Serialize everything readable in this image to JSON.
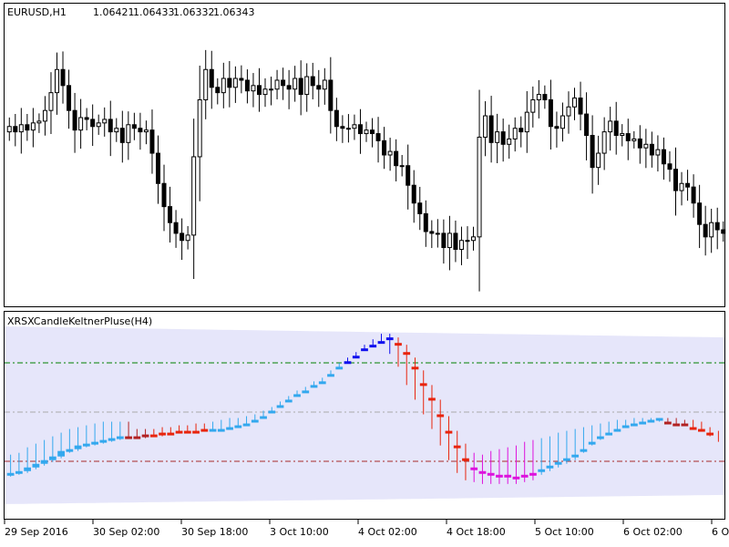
{
  "header": {
    "symbol_label": "EURUSD,H1",
    "ohlc_values": [
      "1.06421",
      "1.06433",
      "1.06332",
      "1.06343"
    ]
  },
  "indicator": {
    "title": "XRSXCandleKeltnerPluse(H4)"
  },
  "time_axis": {
    "labels": [
      "29 Sep 2016",
      "30 Sep 02:00",
      "30 Sep 18:00",
      "3 Oct 10:00",
      "4 Oct 02:00",
      "4 Oct 18:00",
      "5 Oct 10:00",
      "6 Oct 02:00",
      "6 O"
    ]
  },
  "colors": {
    "background": "#ffffff",
    "frame": "#000000",
    "candle_outline": "#000000",
    "band_fill": "#e6e6fa",
    "level_upper": "#008000",
    "level_middle": "#a9a9a9",
    "level_lower": "#a52a2a",
    "light_blue": "#33a8ee",
    "dark_blue": "#1010ee",
    "red": "#e8240c",
    "magenta": "#dd11dd",
    "brown": "#b22222"
  },
  "chart_data": [
    {
      "type": "candlestick",
      "title": "EURUSD,H1",
      "series": [
        {
          "name": "EURUSD,H1",
          "close": [
            1.1196,
            1.1193,
            1.1197,
            1.1194,
            1.1198,
            1.1199,
            1.1205,
            1.1215,
            1.1228,
            1.1219,
            1.1205,
            1.1194,
            1.1201,
            1.12,
            1.1196,
            1.1198,
            1.12,
            1.1193,
            1.1195,
            1.1187,
            1.1197,
            1.1195,
            1.1193,
            1.1194,
            1.1181,
            1.1164,
            1.1151,
            1.1142,
            1.1136,
            1.1132,
            1.1135,
            1.1179,
            1.1211,
            1.1228,
            1.1218,
            1.1215,
            1.1223,
            1.1218,
            1.1223,
            1.1222,
            1.1216,
            1.1219,
            1.1214,
            1.1217,
            1.1217,
            1.1222,
            1.1219,
            1.1217,
            1.1223,
            1.1214,
            1.1224,
            1.1219,
            1.1217,
            1.1222,
            1.1205,
            1.1196,
            1.1195,
            1.1195,
            1.1197,
            1.1192,
            1.1194,
            1.1192,
            1.1188,
            1.118,
            1.1182,
            1.1174,
            1.1174,
            1.1163,
            1.1153,
            1.1147,
            1.1137,
            1.1136,
            1.1136,
            1.1128,
            1.1136,
            1.1127,
            1.1132,
            1.1132,
            1.1134,
            1.119,
            1.1202,
            1.1187,
            1.1193,
            1.1186,
            1.1189,
            1.1195,
            1.1193,
            1.1204,
            1.1211,
            1.1214,
            1.1211,
            1.1196,
            1.1195,
            1.1202,
            1.1207,
            1.1212,
            1.1203,
            1.1191,
            1.1173,
            1.1181,
            1.1193,
            1.1199,
            1.1191,
            1.1192,
            1.1188,
            1.1189,
            1.1184,
            1.1186,
            1.118,
            1.1183,
            1.1175,
            1.1172,
            1.116,
            1.1164,
            1.1162,
            1.1153,
            1.1141,
            1.1134,
            1.1142,
            1.1138,
            1.1136
          ],
          "ylim": [
            1.1095,
            1.1265
          ]
        }
      ]
    },
    {
      "type": "colored-candle-oscillator",
      "title": "XRSXCandleKeltnerPluse(H4)",
      "levels": [
        {
          "name": "upper",
          "value": 80
        },
        {
          "name": "middle",
          "value": 50
        },
        {
          "name": "lower",
          "value": 20
        }
      ],
      "ylim": [
        -3,
        110
      ],
      "series": [
        {
          "name": "XRSXCandleKeltnerPluse(H4)",
          "open": [
            21,
            22,
            23,
            25,
            27,
            29,
            31,
            34,
            35,
            37,
            38,
            39,
            40,
            41,
            42,
            42,
            42,
            43,
            43,
            44,
            45,
            45,
            45,
            46,
            46,
            46,
            47,
            48,
            49,
            51,
            53,
            56,
            59,
            62,
            65,
            67,
            70,
            72,
            76,
            80,
            83,
            86,
            90,
            92,
            94,
            96,
            93,
            88,
            80,
            71,
            63,
            54,
            45,
            37,
            30,
            25,
            23,
            22,
            21,
            21,
            20,
            21,
            22,
            24,
            26,
            28,
            30,
            32,
            35,
            39,
            42,
            44,
            46,
            48,
            49,
            50,
            51,
            52,
            50,
            49,
            49,
            47,
            46,
            44
          ],
          "close": [
            22,
            23,
            25,
            27,
            29,
            31,
            34,
            35,
            37,
            38,
            39,
            40,
            41,
            42,
            42,
            42,
            43,
            43,
            44,
            44,
            45,
            45,
            45,
            46,
            46,
            46,
            47,
            48,
            49,
            51,
            53,
            56,
            59,
            62,
            65,
            67,
            70,
            72,
            76,
            80,
            83,
            86,
            90,
            92,
            94,
            96,
            93,
            88,
            80,
            71,
            63,
            54,
            45,
            37,
            30,
            25,
            23,
            22,
            21,
            21,
            20,
            21,
            22,
            24,
            26,
            28,
            30,
            32,
            35,
            39,
            42,
            44,
            46,
            48,
            49,
            50,
            51,
            52,
            50,
            49,
            49,
            47,
            46,
            44,
            41
          ],
          "high": [
            32,
            33,
            36,
            38,
            40,
            42,
            44,
            46,
            47,
            48,
            49,
            50,
            50,
            50,
            50,
            46,
            46,
            46,
            47,
            47,
            48,
            48,
            49,
            49,
            50,
            51,
            52,
            52,
            53,
            54,
            56,
            58,
            61,
            64,
            67,
            69,
            72,
            74,
            78,
            82,
            85,
            88,
            92,
            95,
            98,
            98,
            96,
            92,
            85,
            78,
            70,
            62,
            53,
            45,
            38,
            33,
            32,
            34,
            35,
            36,
            37,
            39,
            40,
            41,
            42,
            44,
            45,
            46,
            47,
            48,
            49,
            50,
            51,
            51,
            52,
            52,
            52,
            52,
            52,
            52,
            51,
            51,
            50,
            47,
            45
          ],
          "low": [
            20,
            21,
            22,
            24,
            26,
            28,
            30,
            33,
            34,
            36,
            37,
            38,
            39,
            40,
            41,
            41,
            41,
            42,
            42,
            43,
            44,
            44,
            44,
            45,
            45,
            45,
            46,
            47,
            48,
            50,
            52,
            55,
            58,
            61,
            64,
            66,
            69,
            71,
            75,
            79,
            82,
            85,
            89,
            91,
            93,
            87,
            80,
            70,
            62,
            54,
            46,
            37,
            29,
            22,
            18,
            17,
            16,
            16,
            16,
            16,
            16,
            17,
            18,
            21,
            23,
            25,
            27,
            29,
            33,
            37,
            40,
            43,
            45,
            47,
            48,
            49,
            50,
            50,
            49,
            48,
            48,
            46,
            45,
            42,
            39
          ],
          "color_classes": [
            "light_blue",
            "light_blue",
            "light_blue",
            "light_blue",
            "light_blue",
            "light_blue",
            "light_blue",
            "light_blue",
            "light_blue",
            "light_blue",
            "light_blue",
            "light_blue",
            "light_blue",
            "light_blue",
            "brown",
            "brown",
            "brown",
            "red",
            "red",
            "red",
            "red",
            "red",
            "red",
            "red",
            "light_blue",
            "light_blue",
            "light_blue",
            "light_blue",
            "light_blue",
            "light_blue",
            "light_blue",
            "light_blue",
            "light_blue",
            "light_blue",
            "light_blue",
            "light_blue",
            "light_blue",
            "light_blue",
            "light_blue",
            "light_blue",
            "dark_blue",
            "dark_blue",
            "dark_blue",
            "dark_blue",
            "dark_blue",
            "dark_blue",
            "red",
            "red",
            "red",
            "red",
            "red",
            "red",
            "red",
            "red",
            "red",
            "magenta",
            "magenta",
            "magenta",
            "magenta",
            "magenta",
            "magenta",
            "magenta",
            "magenta",
            "light_blue",
            "light_blue",
            "light_blue",
            "light_blue",
            "light_blue",
            "light_blue",
            "light_blue",
            "light_blue",
            "light_blue",
            "light_blue",
            "light_blue",
            "light_blue",
            "light_blue",
            "light_blue",
            "light_blue",
            "brown",
            "brown",
            "brown",
            "red",
            "red",
            "red",
            "red"
          ]
        }
      ],
      "xlabels": [
        "29 Sep 2016",
        "30 Sep 02:00",
        "30 Sep 18:00",
        "3 Oct 10:00",
        "4 Oct 02:00",
        "4 Oct 18:00",
        "5 Oct 10:00",
        "6 Oct 02:00",
        "6 O"
      ]
    }
  ]
}
